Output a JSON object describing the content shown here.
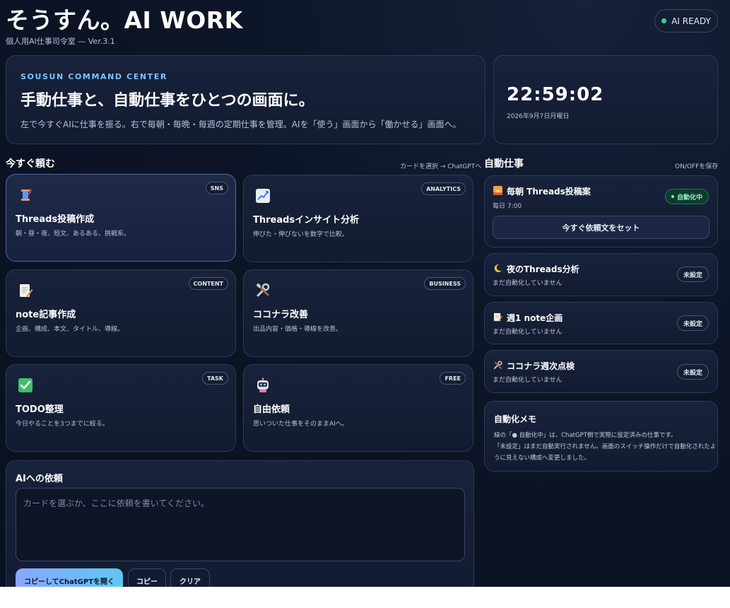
{
  "header": {
    "title": "そうすん。AI WORK",
    "subtitle": "個人用AI仕事司令室 — Ver.3.1",
    "status_badge": "AI READY"
  },
  "hero": {
    "kicker": "SOUSUN COMMAND CENTER",
    "title": "手動仕事と、自動仕事をひとつの画面に。",
    "description": "左で今すぐAIに仕事を振る。右で毎朝・毎晩・毎週の定期仕事を管理。AIを「使う」画面から「働かせる」画面へ。"
  },
  "clock": {
    "time": "22:59:02",
    "date": "2026年9月7日月曜日"
  },
  "manual": {
    "title": "今すぐ頼む",
    "hint": "カードを選択 → ChatGPTへ",
    "cards": [
      {
        "icon": "thread-spool-icon",
        "tag": "SNS",
        "title": "Threads投稿作成",
        "desc": "朝・昼・夜、短文、あるある、挑戦系。",
        "selected": true
      },
      {
        "icon": "chart-increasing-icon",
        "tag": "ANALYTICS",
        "title": "Threadsインサイト分析",
        "desc": "伸びた・伸びないを数字で比較。",
        "selected": false
      },
      {
        "icon": "memo-icon",
        "tag": "CONTENT",
        "title": "note記事作成",
        "desc": "企画、構成、本文、タイトル、導線。",
        "selected": false
      },
      {
        "icon": "tools-icon",
        "tag": "BUSINESS",
        "title": "ココナラ改善",
        "desc": "出品内容・価格・導線を改善。",
        "selected": false
      },
      {
        "icon": "check-mark-icon",
        "tag": "TASK",
        "title": "TODO整理",
        "desc": "今日やることを3つまでに絞る。",
        "selected": false
      },
      {
        "icon": "robot-icon",
        "tag": "FREE",
        "title": "自由依頼",
        "desc": "思いついた仕事をそのままAIへ。",
        "selected": false
      }
    ]
  },
  "request": {
    "title": "AIへの依頼",
    "placeholder": "カードを選ぶか、ここに依頼を書いてください。",
    "value": "",
    "buttons": {
      "copy_open": "コピーしてChatGPTを開く",
      "copy": "コピー",
      "clear": "クリア"
    }
  },
  "auto": {
    "title": "自動仕事",
    "hint": "ON/OFFを保存",
    "jobs": [
      {
        "icon": "sunrise-icon",
        "title": "毎朝 Threads投稿案",
        "sub": "毎日 7:00",
        "status": "自動化中",
        "active": true,
        "action": "今すぐ依頼文をセット"
      },
      {
        "icon": "crescent-moon-icon",
        "title": "夜のThreads分析",
        "sub": "まだ自動化していません",
        "status": "未設定",
        "active": false
      },
      {
        "icon": "memo-icon",
        "title": "週1 note企画",
        "sub": "まだ自動化していません",
        "status": "未設定",
        "active": false
      },
      {
        "icon": "tools-icon",
        "title": "ココナラ週次点検",
        "sub": "まだ自動化していません",
        "status": "未設定",
        "active": false
      }
    ],
    "memo": {
      "title": "自動化メモ",
      "lines": [
        "緑の「● 自動化中」は、ChatGPT側で実際に設定済みの仕事です。",
        "「未設定」はまだ自動実行されません。画面のスイッチ操作だけで自動化されたよ",
        "うに見えない構成へ変更しました。"
      ]
    }
  },
  "colors": {
    "accent": "#7cc4ff",
    "active_green": "#34d399",
    "background": "#0c1426"
  }
}
